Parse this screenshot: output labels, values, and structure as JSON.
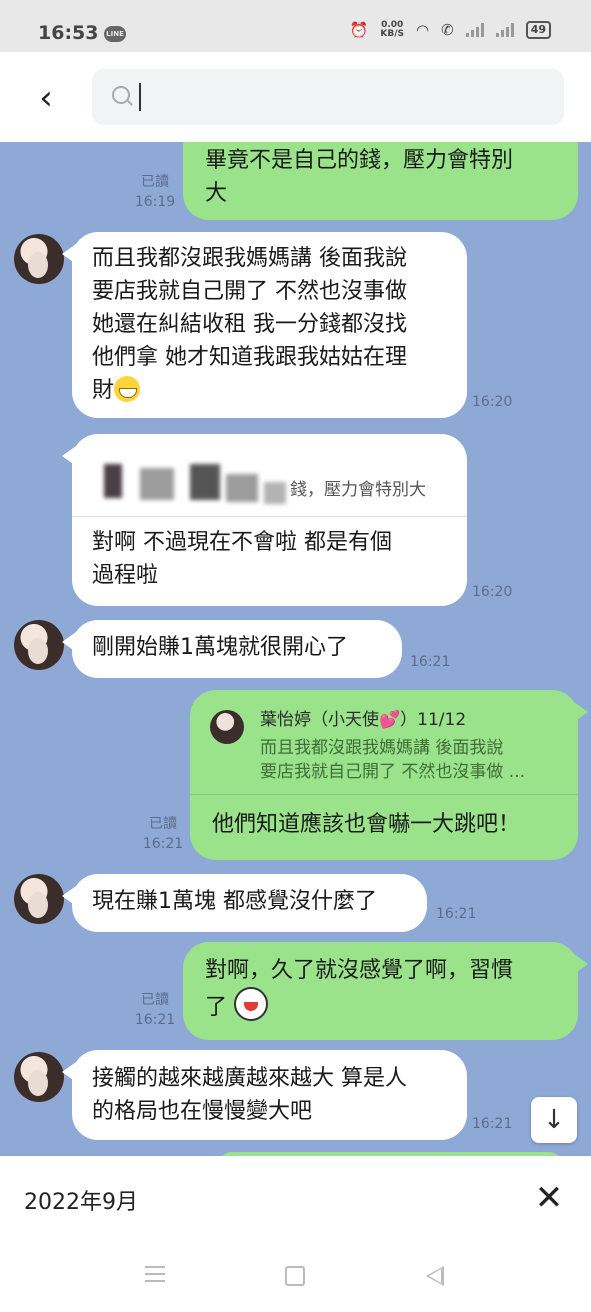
{
  "status_bar": {
    "time": "16:53",
    "app_icon": "LINE",
    "net_speed_value": "0.00",
    "net_speed_unit": "KB/S",
    "battery": "49"
  },
  "search": {
    "placeholder": ""
  },
  "messages": [
    {
      "id": "m1",
      "side": "right",
      "lines": [
        "畢竟不是自己的錢，壓力會特別",
        "大"
      ],
      "read": "已讀",
      "time": "16:19"
    },
    {
      "id": "m2",
      "side": "left",
      "lines": [
        "而且我都沒跟我媽媽講 後面我說",
        "要店我就自己開了 不然也沒事做",
        "她還在糾結收租 我一分錢都沒找",
        "他們拿 她才知道我跟我姑姑在理",
        "財"
      ],
      "emoji": "grin-emoji",
      "time": "16:20"
    },
    {
      "id": "m3",
      "side": "left",
      "quote_snippet": "錢，壓力會特別大",
      "lines": [
        "對啊 不過現在不會啦 都是有個",
        "過程啦"
      ],
      "time": "16:20"
    },
    {
      "id": "m4",
      "side": "left",
      "lines": [
        "剛開始賺1萬塊就很開心了"
      ],
      "time": "16:21"
    },
    {
      "id": "m5",
      "side": "right",
      "reply_name": "葉怡婷（小天使💕）11/12",
      "reply_lines": [
        "而且我都沒跟我媽媽講 後面我說",
        "要店我就自己開了 不然也沒事做 ..."
      ],
      "lines": [
        "他們知道應該也會嚇一大跳吧！"
      ],
      "read": "已讀",
      "time": "16:21"
    },
    {
      "id": "m6",
      "side": "left",
      "lines": [
        "現在賺1萬塊 都感覺沒什麼了"
      ],
      "time": "16:21"
    },
    {
      "id": "m7",
      "side": "right",
      "lines": [
        "對啊，久了就沒感覺了啊，習慣",
        "了"
      ],
      "emoji": "laugh-sticker-emoji",
      "read": "已讀",
      "time": "16:21"
    },
    {
      "id": "m8",
      "side": "left",
      "lines": [
        "接觸的越來越廣越來越大 算是人",
        "的格局也在慢慢變大吧"
      ],
      "time": "16:21"
    }
  ],
  "bottom": {
    "date": "2022年9月"
  },
  "colors": {
    "chat_bg": "#8fa9d6",
    "sent_bubble": "#9ae38b",
    "received_bubble": "#ffffff"
  }
}
